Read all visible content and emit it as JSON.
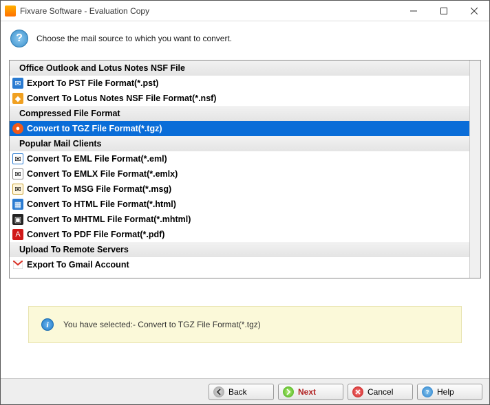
{
  "window": {
    "title": "Fixvare Software - Evaluation Copy"
  },
  "instruction": "Choose the mail source to which you want to convert.",
  "rows": [
    {
      "kind": "header",
      "label": "Office Outlook and Lotus Notes NSF File"
    },
    {
      "kind": "item",
      "icon": "pst",
      "label": "Export To PST File Format(*.pst)"
    },
    {
      "kind": "item",
      "icon": "nsf",
      "label": "Convert To Lotus Notes NSF File Format(*.nsf)"
    },
    {
      "kind": "header",
      "label": "Compressed File Format"
    },
    {
      "kind": "item",
      "icon": "tgz",
      "label": "Convert to TGZ File Format(*.tgz)",
      "selected": true
    },
    {
      "kind": "header",
      "label": "Popular Mail Clients"
    },
    {
      "kind": "item",
      "icon": "eml",
      "label": "Convert To EML File Format(*.eml)"
    },
    {
      "kind": "item",
      "icon": "emlx",
      "label": "Convert To EMLX File Format(*.emlx)"
    },
    {
      "kind": "item",
      "icon": "msg",
      "label": "Convert To MSG File Format(*.msg)"
    },
    {
      "kind": "item",
      "icon": "html",
      "label": "Convert To HTML File Format(*.html)"
    },
    {
      "kind": "item",
      "icon": "mhtml",
      "label": "Convert To MHTML File Format(*.mhtml)"
    },
    {
      "kind": "item",
      "icon": "pdf",
      "label": "Convert To PDF File Format(*.pdf)"
    },
    {
      "kind": "header",
      "label": "Upload To Remote Servers"
    },
    {
      "kind": "item",
      "icon": "gmail",
      "label": "Export To Gmail Account"
    }
  ],
  "notice": "You have selected:- Convert to TGZ File Format(*.tgz)",
  "buttons": {
    "back": "Back",
    "next": "Next",
    "cancel": "Cancel",
    "help": "Help"
  }
}
